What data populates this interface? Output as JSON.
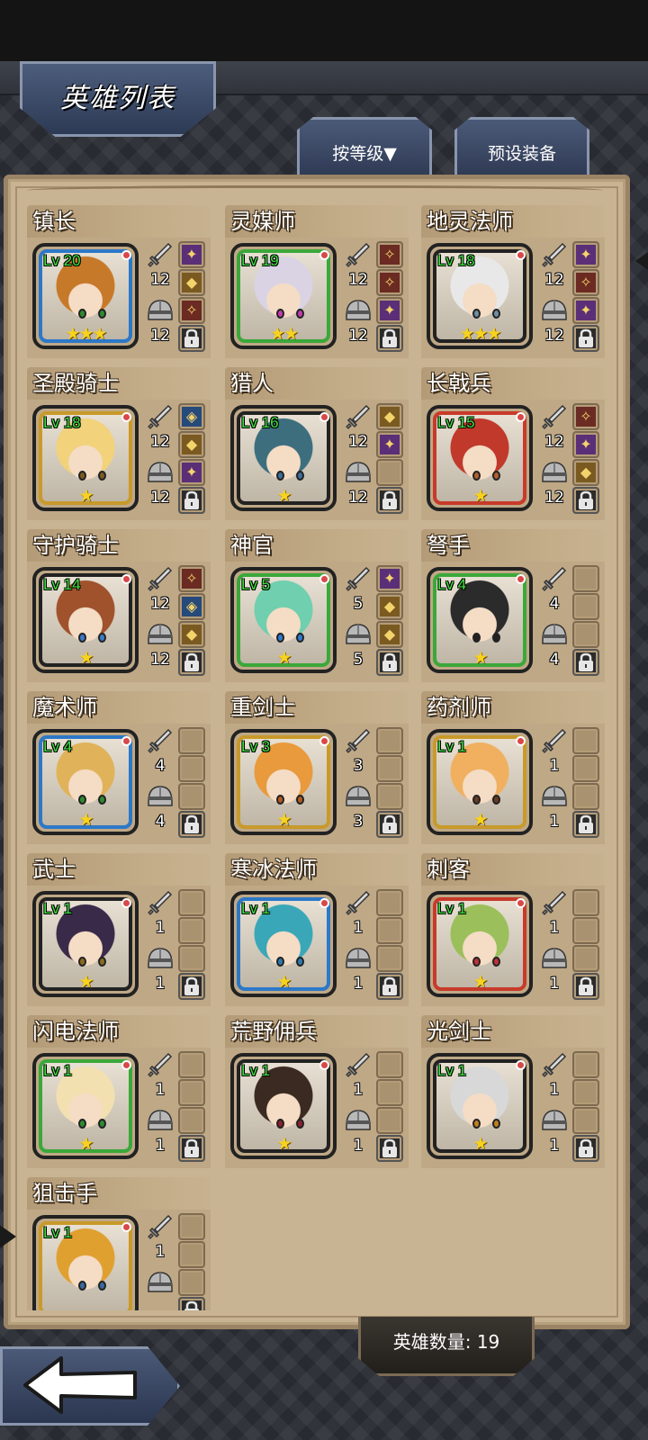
{
  "header": {
    "title": "英雄列表",
    "sort_label": "按等级▼",
    "preset_label": "预设装备"
  },
  "footer": {
    "hero_count_label": "英雄数量: 19"
  },
  "colors": {
    "frame_green": "#3aa83a",
    "frame_blue": "#2c78c8",
    "frame_gold": "#c89a2a",
    "frame_red": "#c83a2a",
    "frame_dark": "#222222",
    "level_green": "#3fe33f",
    "star_gold": "#f7d21e"
  },
  "heroes": [
    {
      "name": "镇长",
      "level": "Lv 20",
      "stars": "★★★",
      "attack": "12",
      "defense": "12",
      "frame": "blue",
      "slots": [
        "purple",
        "gold",
        "red",
        "lock"
      ]
    },
    {
      "name": "灵媒师",
      "level": "Lv 19",
      "stars": "★★",
      "attack": "12",
      "defense": "12",
      "frame": "green",
      "slots": [
        "red",
        "red",
        "purple",
        "lock"
      ]
    },
    {
      "name": "地灵法师",
      "level": "Lv 18",
      "stars": "★★★",
      "attack": "12",
      "defense": "12",
      "frame": "dark",
      "slots": [
        "purple",
        "red",
        "purple",
        "lock"
      ]
    },
    {
      "name": "圣殿骑士",
      "level": "Lv 18",
      "stars": "★",
      "attack": "12",
      "defense": "12",
      "frame": "gold",
      "slots": [
        "blue",
        "gold",
        "purple",
        "lock"
      ]
    },
    {
      "name": "猎人",
      "level": "Lv 16",
      "stars": "★",
      "attack": "12",
      "defense": "12",
      "frame": "dark",
      "slots": [
        "gold",
        "purple",
        "empty",
        "lock"
      ]
    },
    {
      "name": "长戟兵",
      "level": "Lv 15",
      "stars": "★",
      "attack": "12",
      "defense": "12",
      "frame": "red",
      "slots": [
        "red",
        "purple",
        "gold",
        "lock"
      ]
    },
    {
      "name": "守护骑士",
      "level": "Lv 14",
      "stars": "★",
      "attack": "12",
      "defense": "12",
      "frame": "dark",
      "slots": [
        "red",
        "blue",
        "gold",
        "lock"
      ]
    },
    {
      "name": "神官",
      "level": "Lv 5",
      "stars": "★",
      "attack": "5",
      "defense": "5",
      "frame": "green",
      "slots": [
        "purple",
        "gold",
        "gold",
        "lock"
      ]
    },
    {
      "name": "弩手",
      "level": "Lv 4",
      "stars": "★",
      "attack": "4",
      "defense": "4",
      "frame": "green",
      "slots": [
        "empty",
        "empty",
        "empty",
        "lock"
      ]
    },
    {
      "name": "魔术师",
      "level": "Lv 4",
      "stars": "★",
      "attack": "4",
      "defense": "4",
      "frame": "blue",
      "slots": [
        "empty",
        "empty",
        "empty",
        "lock"
      ]
    },
    {
      "name": "重剑士",
      "level": "Lv 3",
      "stars": "★",
      "attack": "3",
      "defense": "3",
      "frame": "gold",
      "slots": [
        "empty",
        "empty",
        "empty",
        "lock"
      ]
    },
    {
      "name": "药剂师",
      "level": "Lv 1",
      "stars": "★",
      "attack": "1",
      "defense": "1",
      "frame": "gold",
      "slots": [
        "empty",
        "empty",
        "empty",
        "lock"
      ]
    },
    {
      "name": "武士",
      "level": "Lv 1",
      "stars": "★",
      "attack": "1",
      "defense": "1",
      "frame": "dark",
      "slots": [
        "empty",
        "empty",
        "empty",
        "lock"
      ]
    },
    {
      "name": "寒冰法师",
      "level": "Lv 1",
      "stars": "★",
      "attack": "1",
      "defense": "1",
      "frame": "blue",
      "slots": [
        "empty",
        "empty",
        "empty",
        "lock"
      ]
    },
    {
      "name": "刺客",
      "level": "Lv 1",
      "stars": "★",
      "attack": "1",
      "defense": "1",
      "frame": "red",
      "slots": [
        "empty",
        "empty",
        "empty",
        "lock"
      ]
    },
    {
      "name": "闪电法师",
      "level": "Lv 1",
      "stars": "★",
      "attack": "1",
      "defense": "1",
      "frame": "green",
      "slots": [
        "empty",
        "empty",
        "empty",
        "lock"
      ]
    },
    {
      "name": "荒野佣兵",
      "level": "Lv 1",
      "stars": "★",
      "attack": "1",
      "defense": "1",
      "frame": "dark",
      "slots": [
        "empty",
        "empty",
        "empty",
        "lock"
      ]
    },
    {
      "name": "光剑士",
      "level": "Lv 1",
      "stars": "★",
      "attack": "1",
      "defense": "1",
      "frame": "dark",
      "slots": [
        "empty",
        "empty",
        "empty",
        "lock"
      ]
    },
    {
      "name": "狙击手",
      "level": "Lv 1",
      "stars": "",
      "attack": "1",
      "defense": "",
      "frame": "gold",
      "slots": [
        "empty",
        "empty",
        "empty",
        "lock"
      ]
    }
  ]
}
